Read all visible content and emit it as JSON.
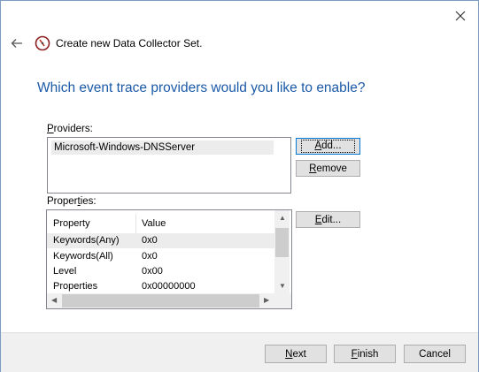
{
  "window": {
    "title": "Create new Data Collector Set.",
    "question": "Which event trace providers would you like to enable?"
  },
  "icons": {
    "close": "close-icon",
    "back": "back-arrow-icon",
    "wizard": "data-collector-set-icon"
  },
  "providers": {
    "label_first": "P",
    "label_rest": "roviders:",
    "items": [
      "Microsoft-Windows-DNSServer"
    ],
    "add_first": "A",
    "add_rest": "dd...",
    "remove_first": "R",
    "remove_rest": "emove"
  },
  "properties": {
    "label_before": "Proper",
    "label_u": "t",
    "label_after": "ies:",
    "columns": [
      "Property",
      "Value"
    ],
    "rows": [
      {
        "property": "Keywords(Any)",
        "value": "0x0"
      },
      {
        "property": "Keywords(All)",
        "value": "0x0"
      },
      {
        "property": "Level",
        "value": "0x00"
      },
      {
        "property": "Properties",
        "value": "0x00000000"
      }
    ],
    "edit_first": "E",
    "edit_rest": "dit..."
  },
  "footer": {
    "next_first": "N",
    "next_rest": "ext",
    "finish_first": "F",
    "finish_rest": "inish",
    "cancel": "Cancel"
  }
}
